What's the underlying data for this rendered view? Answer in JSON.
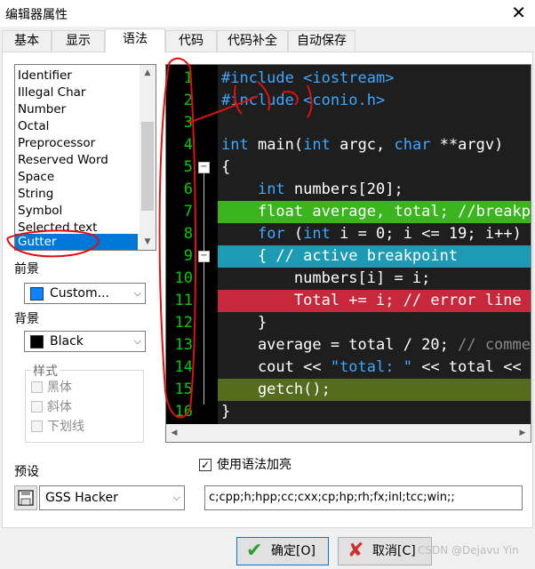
{
  "window": {
    "title": "编辑器属性"
  },
  "tabs": [
    {
      "label": "基本"
    },
    {
      "label": "显示"
    },
    {
      "label": "语法"
    },
    {
      "label": "代码"
    },
    {
      "label": "代码补全"
    },
    {
      "label": "自动保存"
    }
  ],
  "token_list": {
    "items": [
      "Identifier",
      "Illegal Char",
      "Number",
      "Octal",
      "Preprocessor",
      "Reserved Word",
      "Space",
      "String",
      "Symbol",
      "Selected text",
      "Gutter"
    ],
    "selected": "Gutter"
  },
  "foreground": {
    "label": "前景",
    "value": "Custom...",
    "color": "#0a84ff"
  },
  "background": {
    "label": "背景",
    "value": "Black",
    "color": "#000000"
  },
  "style": {
    "legend": "样式",
    "options": [
      "黑体",
      "斜体",
      "下划线"
    ]
  },
  "editor": {
    "line_numbers": [
      "1",
      "2",
      "3",
      "4",
      "5",
      "6",
      "7",
      "8",
      "9",
      "10",
      "11",
      "12",
      "13",
      "14",
      "15",
      "16"
    ],
    "lines": [
      {
        "segments": [
          {
            "t": "#include <iostream>",
            "c": "dir"
          }
        ]
      },
      {
        "segments": [
          {
            "t": "#include <conio.h>",
            "c": "dir"
          }
        ]
      },
      {
        "segments": [
          {
            "t": "",
            "c": ""
          }
        ]
      },
      {
        "segments": [
          {
            "t": "int",
            "c": "kw"
          },
          {
            "t": " main(",
            "c": ""
          },
          {
            "t": "int",
            "c": "kw"
          },
          {
            "t": " argc, ",
            "c": ""
          },
          {
            "t": "char",
            "c": "kw"
          },
          {
            "t": " **argv)",
            "c": ""
          }
        ]
      },
      {
        "segments": [
          {
            "t": "{",
            "c": ""
          }
        ]
      },
      {
        "segments": [
          {
            "t": "    ",
            "c": ""
          },
          {
            "t": "int",
            "c": "kw"
          },
          {
            "t": " numbers[20];",
            "c": ""
          }
        ]
      },
      {
        "segments": [
          {
            "t": "    float average, total; //breakpoint",
            "c": ""
          }
        ],
        "bg": "#3cb41e"
      },
      {
        "segments": [
          {
            "t": "    ",
            "c": ""
          },
          {
            "t": "for",
            "c": "kw"
          },
          {
            "t": " (",
            "c": ""
          },
          {
            "t": "int",
            "c": "kw"
          },
          {
            "t": " i = 0; i <= 19; i++)",
            "c": ""
          }
        ]
      },
      {
        "segments": [
          {
            "t": "    { // active breakpoint",
            "c": ""
          }
        ],
        "bg": "#1e9bb4"
      },
      {
        "segments": [
          {
            "t": "        numbers[i] = i;",
            "c": ""
          }
        ]
      },
      {
        "segments": [
          {
            "t": "        Total += i; // error line",
            "c": ""
          }
        ],
        "bg": "#c8283c"
      },
      {
        "segments": [
          {
            "t": "    }",
            "c": ""
          }
        ]
      },
      {
        "segments": [
          {
            "t": "    average = total / 20; ",
            "c": ""
          },
          {
            "t": "// comment",
            "c": "cmt"
          }
        ]
      },
      {
        "segments": [
          {
            "t": "    cout << ",
            "c": ""
          },
          {
            "t": "\"total: \"",
            "c": "str"
          },
          {
            "t": " << total << endl;",
            "c": ""
          }
        ]
      },
      {
        "segments": [
          {
            "t": "    getch();",
            "c": ""
          }
        ],
        "bg": "#556b1e"
      },
      {
        "segments": [
          {
            "t": "}",
            "c": ""
          }
        ]
      }
    ]
  },
  "preset": {
    "label": "预设",
    "value": "GSS Hacker"
  },
  "syntax_highlight": {
    "label": "使用语法加亮",
    "checked": true
  },
  "extensions": {
    "value": "c;cpp;h;hpp;cc;cxx;cp;hp;rh;fx;inl;tcc;win;;"
  },
  "buttons": {
    "ok": "确定[O]",
    "cancel": "取消[C]"
  },
  "watermark": "CSDN @Dejavu Yin"
}
